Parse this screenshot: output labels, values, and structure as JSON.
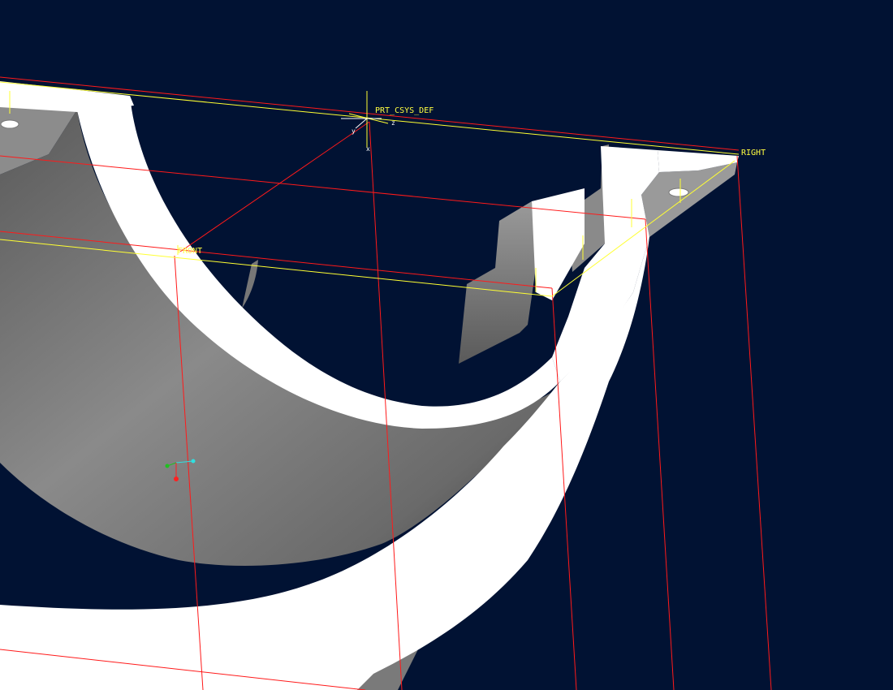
{
  "viewport": {
    "background": "#011233",
    "model_color": "#ffffff",
    "datum_plane_color": "#ff1a1a",
    "datum_highlight_color": "#ffff33"
  },
  "datums": {
    "csys_label": "PRT_CSYS_DEF",
    "csys_axes": {
      "x": "x",
      "y": "y",
      "z": "z"
    },
    "plane_right": "RIGHT",
    "plane_front": "FRONT"
  },
  "spin_center": {
    "x_color": "#ff2020",
    "y_color": "#20c020",
    "z_color": "#30e0e0"
  }
}
